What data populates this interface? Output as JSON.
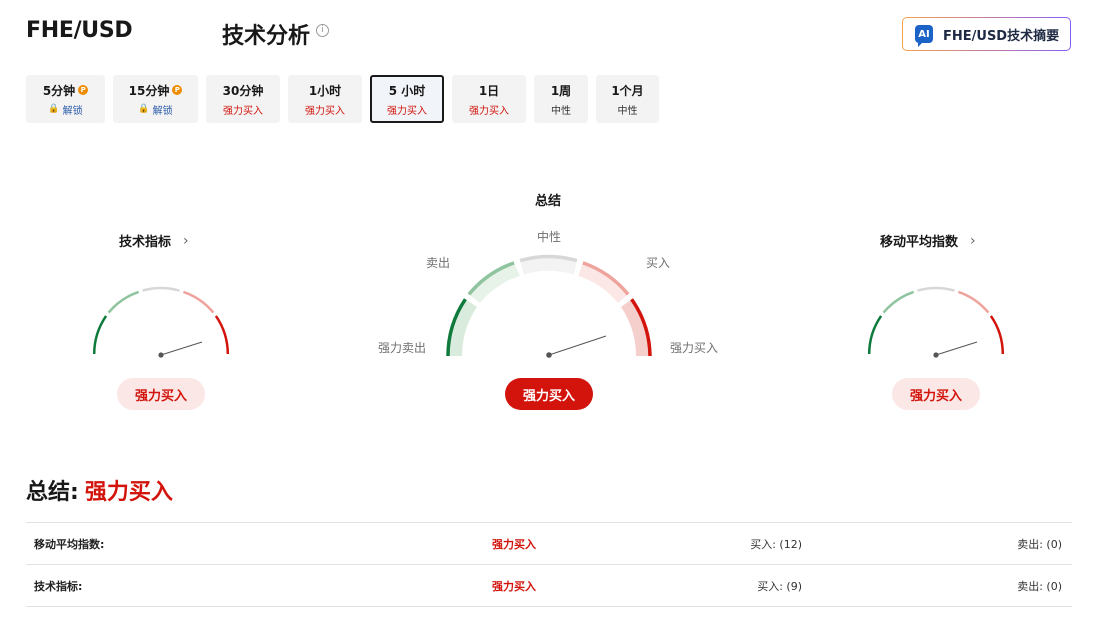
{
  "header": {
    "pair": "FHE/USD",
    "section_title": "技术分析",
    "info_icon": "info-icon",
    "ai_badge": "AI",
    "ai_button_label": "FHE/USD技术摘要"
  },
  "tabs": [
    {
      "label": "5分钟",
      "sub": "解锁",
      "pro": true,
      "locked": true
    },
    {
      "label": "15分钟",
      "sub": "解锁",
      "pro": true,
      "locked": true
    },
    {
      "label": "30分钟",
      "sub": "强力买入"
    },
    {
      "label": "1小时",
      "sub": "强力买入"
    },
    {
      "label": "5 小时",
      "sub": "强力买入",
      "active": true
    },
    {
      "label": "1日",
      "sub": "强力买入"
    },
    {
      "label": "1周",
      "sub": "中性"
    },
    {
      "label": "1个月",
      "sub": "中性"
    }
  ],
  "gauges": {
    "left": {
      "title": "技术指标",
      "verdict": "强力买入"
    },
    "center": {
      "title": "总结",
      "verdict": "强力买入",
      "labels": {
        "strong_sell": "强力卖出",
        "sell": "卖出",
        "neutral": "中性",
        "buy": "买入",
        "strong_buy": "强力买入"
      }
    },
    "right": {
      "title": "移动平均指数",
      "verdict": "强力买入"
    }
  },
  "summary": {
    "label": "总结:",
    "value": "强力买入",
    "rows": [
      {
        "name": "移动平均指数:",
        "verdict": "强力买入",
        "buy": "买入: (12)",
        "sell": "卖出: (0)"
      },
      {
        "name": "技术指标:",
        "verdict": "强力买入",
        "buy": "买入: (9)",
        "sell": "卖出: (0)"
      }
    ]
  },
  "colors": {
    "strong_sell": "#0e7a3b",
    "sell": "#8fc49e",
    "neutral": "#d7d7d7",
    "buy": "#efa39d",
    "strong_buy": "#d2140c"
  }
}
